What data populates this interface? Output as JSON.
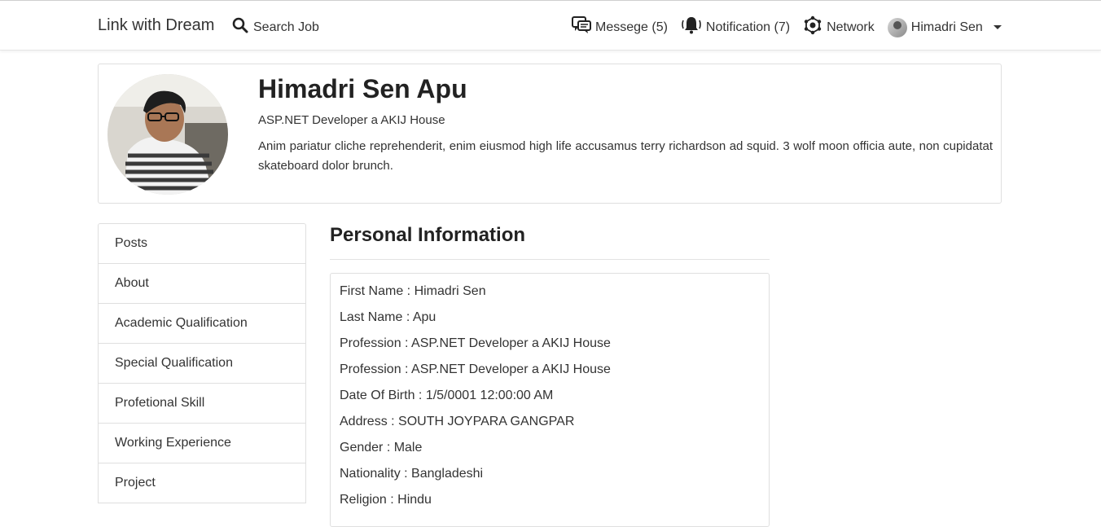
{
  "navbar": {
    "brand": "Link with Dream",
    "search_label": "Search Job",
    "messages_label": "Messege (5)",
    "notifications_label": "Notification (7)",
    "network_label": "Network",
    "user_label": "Himadri Sen"
  },
  "profile": {
    "name": "Himadri Sen Apu",
    "headline": "ASP.NET Developer a AKIJ House",
    "bio": "Anim pariatur cliche reprehenderit, enim eiusmod high life accusamus terry richardson ad squid. 3 wolf moon officia aute, non cupidatat skateboard dolor brunch."
  },
  "sidebar": {
    "items": [
      {
        "label": "Posts"
      },
      {
        "label": "About"
      },
      {
        "label": "Academic Qualification"
      },
      {
        "label": "Special Qualification"
      },
      {
        "label": "Profetional Skill"
      },
      {
        "label": "Working Experience"
      },
      {
        "label": "Project"
      }
    ]
  },
  "main": {
    "section_title": "Personal Information",
    "info_lines": [
      "First Name : Himadri Sen",
      "Last Name : Apu",
      "Profession : ASP.NET Developer a AKIJ House",
      "Profession : ASP.NET Developer a AKIJ House",
      "Date Of Birth : 1/5/0001 12:00:00 AM",
      "Address : SOUTH JOYPARA GANGPAR",
      "Gender : Male",
      "Nationality : Bangladeshi",
      "Religion : Hindu"
    ]
  }
}
